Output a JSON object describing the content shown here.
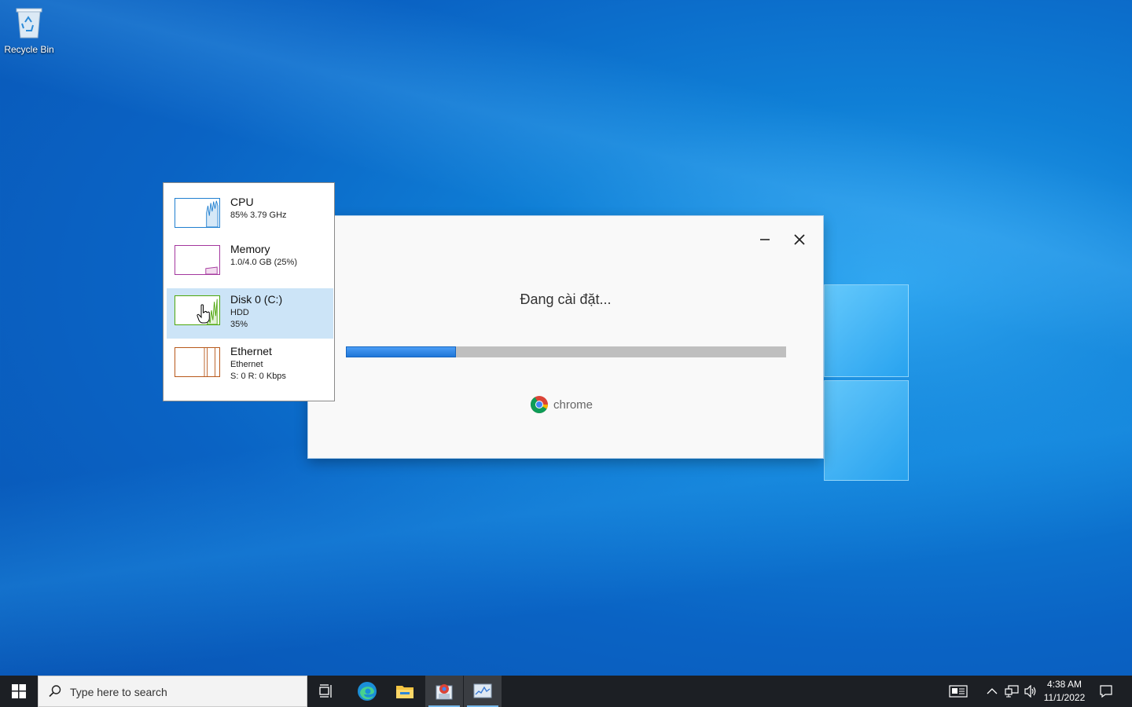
{
  "desktop": {
    "recycle_bin_label": "Recycle Bin"
  },
  "installer": {
    "status_text": "Đang cài đặt...",
    "progress_fraction": 0.25,
    "brand_text": "chrome"
  },
  "task_manager": {
    "items": [
      {
        "title": "CPU",
        "line1": "85% 3.79 GHz",
        "line2": "",
        "color": "#1f7fd0"
      },
      {
        "title": "Memory",
        "line1": "1.0/4.0 GB (25%)",
        "line2": "",
        "color": "#a4379e"
      },
      {
        "title": "Disk 0 (C:)",
        "line1": "HDD",
        "line2": "35%",
        "color": "#4da60c"
      },
      {
        "title": "Ethernet",
        "line1": "Ethernet",
        "line2": "S: 0 R: 0 Kbps",
        "color": "#b8581a"
      }
    ],
    "selected_index": 2
  },
  "taskbar": {
    "search_placeholder": "Type here to search",
    "apps": [
      "task-view-icon",
      "edge-icon",
      "file-explorer-icon",
      "chrome-installer-icon",
      "task-manager-icon"
    ],
    "active_app": "task-manager-icon",
    "clock_time": "4:38 AM",
    "clock_date": "11/1/2022"
  },
  "colors": {
    "accent": "#0078d7",
    "progress_fill": "#1f76d8",
    "taskbar_bg": "#1c1f24"
  }
}
